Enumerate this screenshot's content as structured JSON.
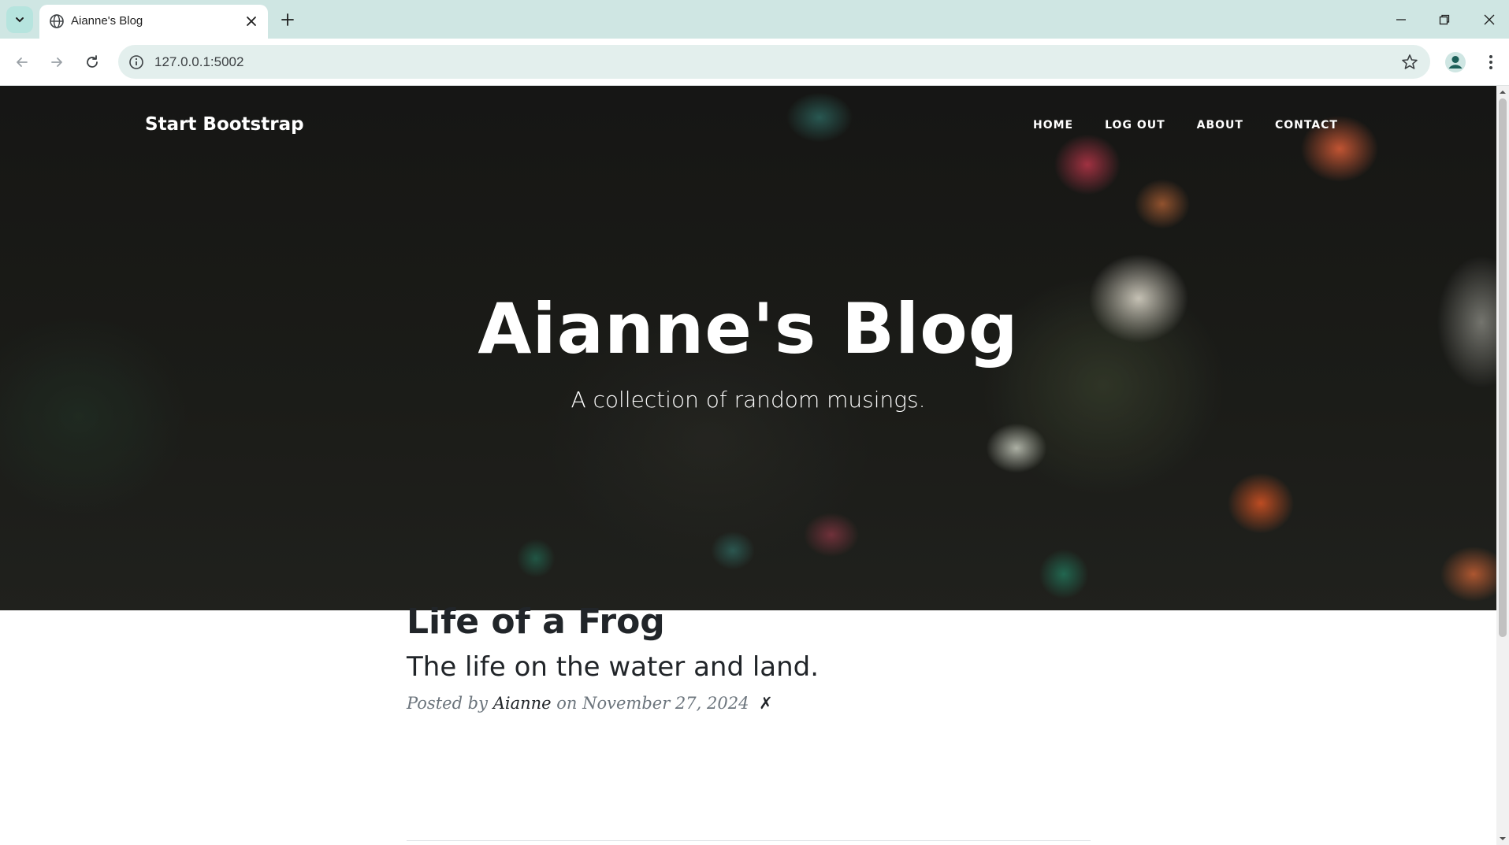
{
  "browser": {
    "tab_title": "Aianne's Blog",
    "url": "127.0.0.1:5002"
  },
  "site": {
    "brand": "Start Bootstrap",
    "nav": [
      {
        "label": "HOME"
      },
      {
        "label": "LOG OUT"
      },
      {
        "label": "ABOUT"
      },
      {
        "label": "CONTACT"
      }
    ]
  },
  "hero": {
    "title": "Aianne's Blog",
    "subtitle": "A collection of random musings."
  },
  "posts": [
    {
      "title": "Life of a Frog",
      "subtitle": "The life on the water and land.",
      "posted_by_prefix": "Posted by",
      "author": "Aianne",
      "date_prefix": "on",
      "date": "November 27, 2024",
      "delete_glyph": "✗"
    }
  ],
  "colors": {
    "tabstrip": "#cfe6e3",
    "omnibox": "#e3efed",
    "text_dark": "#212529",
    "text_muted": "#6c757d"
  }
}
